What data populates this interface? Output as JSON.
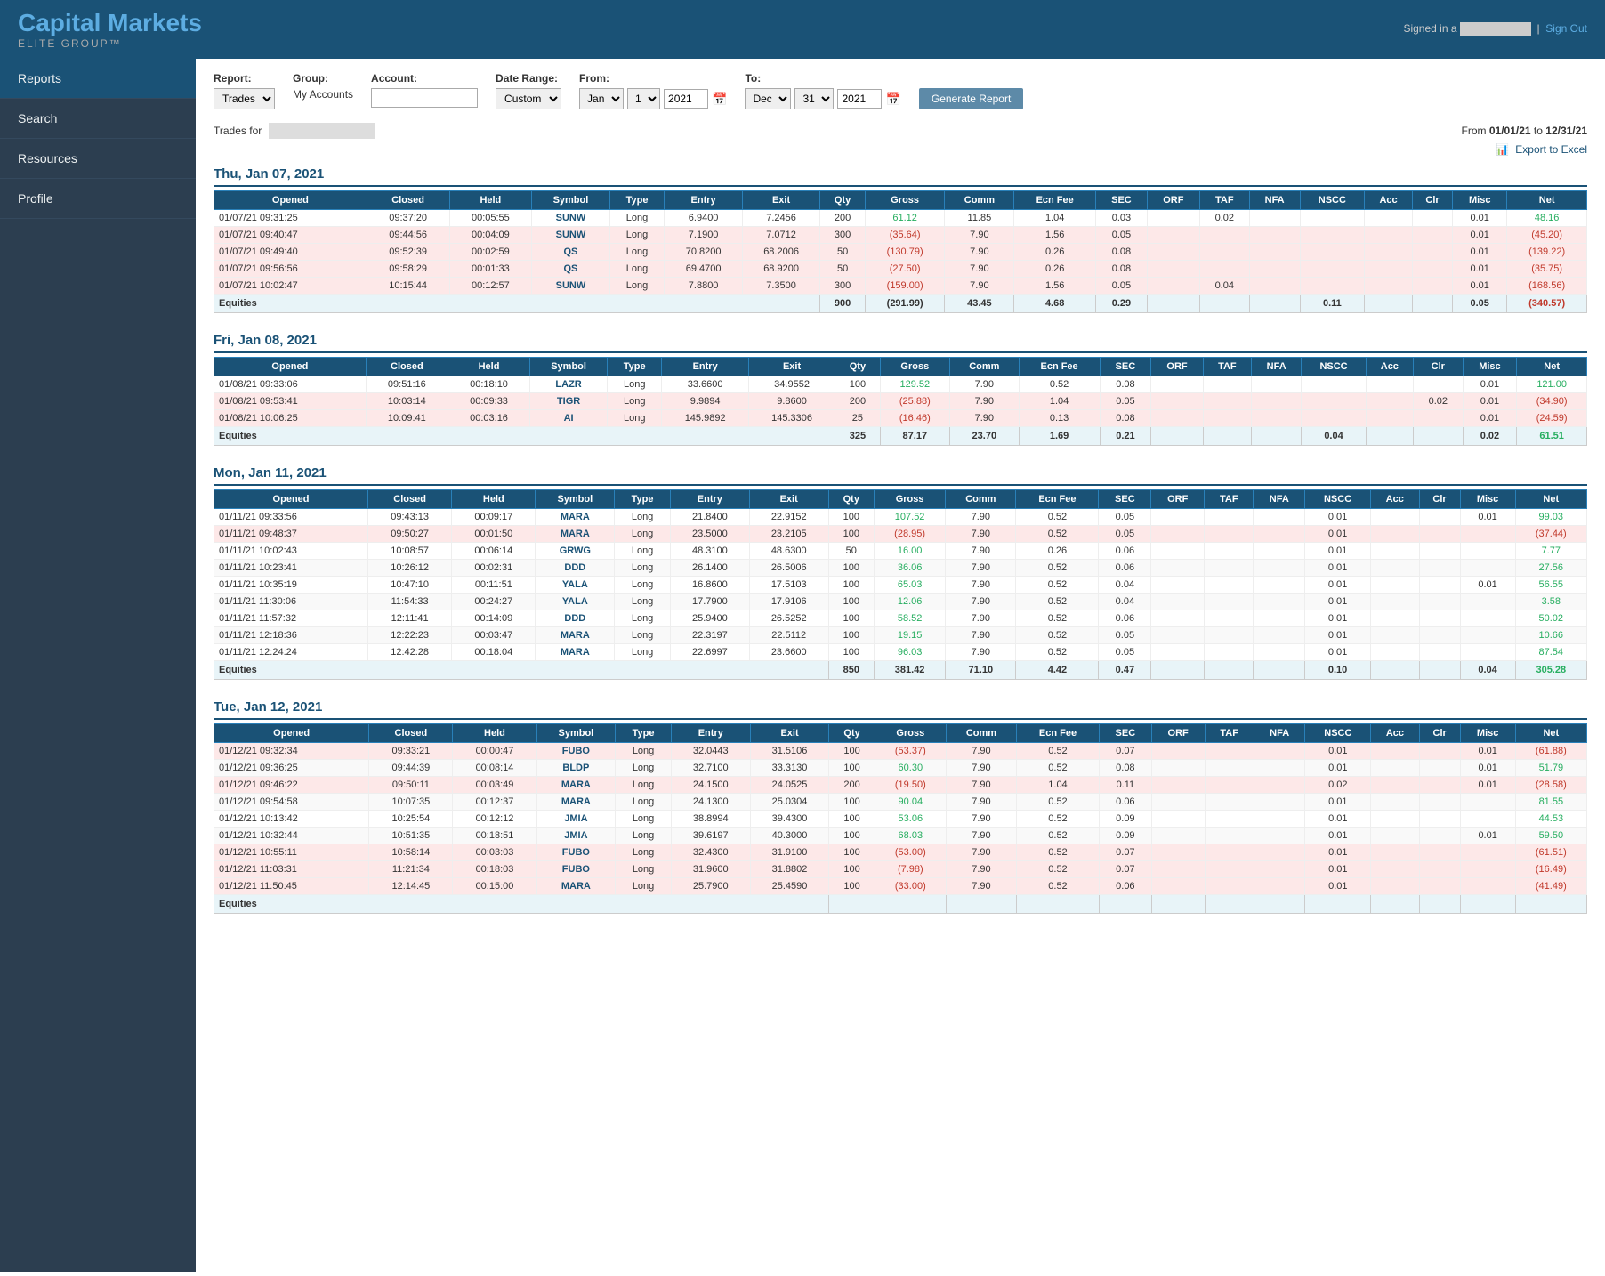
{
  "header": {
    "title": "Capital Markets",
    "subtitle": "ELITE GROUP™",
    "signed_in_label": "Signed in a",
    "sign_out_label": "Sign Out"
  },
  "sidebar": {
    "items": [
      {
        "label": "Reports",
        "active": true
      },
      {
        "label": "Search",
        "active": false
      },
      {
        "label": "Resources",
        "active": false
      },
      {
        "label": "Profile",
        "active": false
      }
    ]
  },
  "controls": {
    "report_label": "Report:",
    "report_value": "Trades",
    "group_label": "Group:",
    "group_value": "My Accounts",
    "account_label": "Account:",
    "account_value": "",
    "date_range_label": "Date Range:",
    "date_range_value": "Custom",
    "from_label": "From:",
    "from_month": "Jan",
    "from_day": "1",
    "from_year": "2021",
    "to_label": "To:",
    "to_month": "Dec",
    "to_day": "31",
    "to_year": "2021",
    "generate_button": "Generate Report"
  },
  "trades_for_label": "Trades for",
  "date_range_display": "From 01/01/21 to 12/31/21",
  "export_label": "Export to Excel",
  "days": [
    {
      "header": "Thu, Jan 07, 2021",
      "columns": [
        "Opened",
        "Closed",
        "Held",
        "Symbol",
        "Type",
        "Entry",
        "Exit",
        "Qty",
        "Gross",
        "Comm",
        "Ecn Fee",
        "SEC",
        "ORF",
        "TAF",
        "NFA",
        "NSCC",
        "Acc",
        "Clr",
        "Misc",
        "Net"
      ],
      "rows": [
        {
          "opened": "01/07/21 09:31:25",
          "closed": "09:37:20",
          "held": "00:05:55",
          "symbol": "SUNW",
          "type": "Long",
          "entry": "6.9400",
          "exit": "7.2456",
          "qty": "200",
          "gross": "61.12",
          "comm": "11.85",
          "ecn": "1.04",
          "sec": "0.03",
          "orf": "",
          "taf": "0.02",
          "nfa": "",
          "nscc": "",
          "acc": "",
          "clr": "",
          "misc": "0.01",
          "net": "48.16",
          "neg": false
        },
        {
          "opened": "01/07/21 09:40:47",
          "closed": "09:44:56",
          "held": "00:04:09",
          "symbol": "SUNW",
          "type": "Long",
          "entry": "7.1900",
          "exit": "7.0712",
          "qty": "300",
          "gross": "(35.64)",
          "comm": "7.90",
          "ecn": "1.56",
          "sec": "0.05",
          "orf": "",
          "taf": "",
          "nfa": "",
          "nscc": "",
          "acc": "",
          "clr": "",
          "misc": "0.01",
          "net": "(45.20)",
          "neg": true
        },
        {
          "opened": "01/07/21 09:49:40",
          "closed": "09:52:39",
          "held": "00:02:59",
          "symbol": "QS",
          "type": "Long",
          "entry": "70.8200",
          "exit": "68.2006",
          "qty": "50",
          "gross": "(130.79)",
          "comm": "7.90",
          "ecn": "0.26",
          "sec": "0.08",
          "orf": "",
          "taf": "",
          "nfa": "",
          "nscc": "",
          "acc": "",
          "clr": "",
          "misc": "0.01",
          "net": "(139.22)",
          "neg": true
        },
        {
          "opened": "01/07/21 09:56:56",
          "closed": "09:58:29",
          "held": "00:01:33",
          "symbol": "QS",
          "type": "Long",
          "entry": "69.4700",
          "exit": "68.9200",
          "qty": "50",
          "gross": "(27.50)",
          "comm": "7.90",
          "ecn": "0.26",
          "sec": "0.08",
          "orf": "",
          "taf": "",
          "nfa": "",
          "nscc": "",
          "acc": "",
          "clr": "",
          "misc": "0.01",
          "net": "(35.75)",
          "neg": true
        },
        {
          "opened": "01/07/21 10:02:47",
          "closed": "10:15:44",
          "held": "00:12:57",
          "symbol": "SUNW",
          "type": "Long",
          "entry": "7.8800",
          "exit": "7.3500",
          "qty": "300",
          "gross": "(159.00)",
          "comm": "7.90",
          "ecn": "1.56",
          "sec": "0.05",
          "orf": "",
          "taf": "0.04",
          "nfa": "",
          "nscc": "",
          "acc": "",
          "clr": "",
          "misc": "0.01",
          "net": "(168.56)",
          "neg": true
        }
      ],
      "footer": {
        "label": "Equities",
        "qty": "900",
        "gross": "(291.99)",
        "comm": "43.45",
        "ecn": "4.68",
        "sec": "0.29",
        "orf": "",
        "taf": "",
        "nfa": "",
        "nscc": "0.11",
        "acc": "",
        "clr": "",
        "misc": "0.05",
        "net": "(340.57)",
        "neg": true
      }
    },
    {
      "header": "Fri, Jan 08, 2021",
      "columns": [
        "Opened",
        "Closed",
        "Held",
        "Symbol",
        "Type",
        "Entry",
        "Exit",
        "Qty",
        "Gross",
        "Comm",
        "Ecn Fee",
        "SEC",
        "ORF",
        "TAF",
        "NFA",
        "NSCC",
        "Acc",
        "Clr",
        "Misc",
        "Net"
      ],
      "rows": [
        {
          "opened": "01/08/21 09:33:06",
          "closed": "09:51:16",
          "held": "00:18:10",
          "symbol": "LAZR",
          "type": "Long",
          "entry": "33.6600",
          "exit": "34.9552",
          "qty": "100",
          "gross": "129.52",
          "comm": "7.90",
          "ecn": "0.52",
          "sec": "0.08",
          "orf": "",
          "taf": "",
          "nfa": "",
          "nscc": "",
          "acc": "",
          "clr": "",
          "misc": "0.01",
          "net": "121.00",
          "neg": false
        },
        {
          "opened": "01/08/21 09:53:41",
          "closed": "10:03:14",
          "held": "00:09:33",
          "symbol": "TIGR",
          "type": "Long",
          "entry": "9.9894",
          "exit": "9.8600",
          "qty": "200",
          "gross": "(25.88)",
          "comm": "7.90",
          "ecn": "1.04",
          "sec": "0.05",
          "orf": "",
          "taf": "",
          "nfa": "",
          "nscc": "",
          "acc": "",
          "clr": "0.02",
          "misc": "0.01",
          "net": "(34.90)",
          "neg": true
        },
        {
          "opened": "01/08/21 10:06:25",
          "closed": "10:09:41",
          "held": "00:03:16",
          "symbol": "AI",
          "type": "Long",
          "entry": "145.9892",
          "exit": "145.3306",
          "qty": "25",
          "gross": "(16.46)",
          "comm": "7.90",
          "ecn": "0.13",
          "sec": "0.08",
          "orf": "",
          "taf": "",
          "nfa": "",
          "nscc": "",
          "acc": "",
          "clr": "",
          "misc": "0.01",
          "net": "(24.59)",
          "neg": true
        }
      ],
      "footer": {
        "label": "Equities",
        "qty": "325",
        "gross": "87.17",
        "comm": "23.70",
        "ecn": "1.69",
        "sec": "0.21",
        "orf": "",
        "taf": "",
        "nfa": "",
        "nscc": "0.04",
        "acc": "",
        "clr": "",
        "misc": "0.02",
        "net": "61.51",
        "neg": false
      }
    },
    {
      "header": "Mon, Jan 11, 2021",
      "columns": [
        "Opened",
        "Closed",
        "Held",
        "Symbol",
        "Type",
        "Entry",
        "Exit",
        "Qty",
        "Gross",
        "Comm",
        "Ecn Fee",
        "SEC",
        "ORF",
        "TAF",
        "NFA",
        "NSCC",
        "Acc",
        "Clr",
        "Misc",
        "Net"
      ],
      "rows": [
        {
          "opened": "01/11/21 09:33:56",
          "closed": "09:43:13",
          "held": "00:09:17",
          "symbol": "MARA",
          "type": "Long",
          "entry": "21.8400",
          "exit": "22.9152",
          "qty": "100",
          "gross": "107.52",
          "comm": "7.90",
          "ecn": "0.52",
          "sec": "0.05",
          "orf": "",
          "taf": "",
          "nfa": "",
          "nscc": "0.01",
          "acc": "",
          "clr": "",
          "misc": "0.01",
          "net": "99.03",
          "neg": false
        },
        {
          "opened": "01/11/21 09:48:37",
          "closed": "09:50:27",
          "held": "00:01:50",
          "symbol": "MARA",
          "type": "Long",
          "entry": "23.5000",
          "exit": "23.2105",
          "qty": "100",
          "gross": "(28.95)",
          "comm": "7.90",
          "ecn": "0.52",
          "sec": "0.05",
          "orf": "",
          "taf": "",
          "nfa": "",
          "nscc": "0.01",
          "acc": "",
          "clr": "",
          "misc": "",
          "net": "(37.44)",
          "neg": true
        },
        {
          "opened": "01/11/21 10:02:43",
          "closed": "10:08:57",
          "held": "00:06:14",
          "symbol": "GRWG",
          "type": "Long",
          "entry": "48.3100",
          "exit": "48.6300",
          "qty": "50",
          "gross": "16.00",
          "comm": "7.90",
          "ecn": "0.26",
          "sec": "0.06",
          "orf": "",
          "taf": "",
          "nfa": "",
          "nscc": "0.01",
          "acc": "",
          "clr": "",
          "misc": "",
          "net": "7.77",
          "neg": false
        },
        {
          "opened": "01/11/21 10:23:41",
          "closed": "10:26:12",
          "held": "00:02:31",
          "symbol": "DDD",
          "type": "Long",
          "entry": "26.1400",
          "exit": "26.5006",
          "qty": "100",
          "gross": "36.06",
          "comm": "7.90",
          "ecn": "0.52",
          "sec": "0.06",
          "orf": "",
          "taf": "",
          "nfa": "",
          "nscc": "0.01",
          "acc": "",
          "clr": "",
          "misc": "",
          "net": "27.56",
          "neg": false
        },
        {
          "opened": "01/11/21 10:35:19",
          "closed": "10:47:10",
          "held": "00:11:51",
          "symbol": "YALA",
          "type": "Long",
          "entry": "16.8600",
          "exit": "17.5103",
          "qty": "100",
          "gross": "65.03",
          "comm": "7.90",
          "ecn": "0.52",
          "sec": "0.04",
          "orf": "",
          "taf": "",
          "nfa": "",
          "nscc": "0.01",
          "acc": "",
          "clr": "",
          "misc": "0.01",
          "net": "56.55",
          "neg": false
        },
        {
          "opened": "01/11/21 11:30:06",
          "closed": "11:54:33",
          "held": "00:24:27",
          "symbol": "YALA",
          "type": "Long",
          "entry": "17.7900",
          "exit": "17.9106",
          "qty": "100",
          "gross": "12.06",
          "comm": "7.90",
          "ecn": "0.52",
          "sec": "0.04",
          "orf": "",
          "taf": "",
          "nfa": "",
          "nscc": "0.01",
          "acc": "",
          "clr": "",
          "misc": "",
          "net": "3.58",
          "neg": false
        },
        {
          "opened": "01/11/21 11:57:32",
          "closed": "12:11:41",
          "held": "00:14:09",
          "symbol": "DDD",
          "type": "Long",
          "entry": "25.9400",
          "exit": "26.5252",
          "qty": "100",
          "gross": "58.52",
          "comm": "7.90",
          "ecn": "0.52",
          "sec": "0.06",
          "orf": "",
          "taf": "",
          "nfa": "",
          "nscc": "0.01",
          "acc": "",
          "clr": "",
          "misc": "",
          "net": "50.02",
          "neg": false
        },
        {
          "opened": "01/11/21 12:18:36",
          "closed": "12:22:23",
          "held": "00:03:47",
          "symbol": "MARA",
          "type": "Long",
          "entry": "22.3197",
          "exit": "22.5112",
          "qty": "100",
          "gross": "19.15",
          "comm": "7.90",
          "ecn": "0.52",
          "sec": "0.05",
          "orf": "",
          "taf": "",
          "nfa": "",
          "nscc": "0.01",
          "acc": "",
          "clr": "",
          "misc": "",
          "net": "10.66",
          "neg": false
        },
        {
          "opened": "01/11/21 12:24:24",
          "closed": "12:42:28",
          "held": "00:18:04",
          "symbol": "MARA",
          "type": "Long",
          "entry": "22.6997",
          "exit": "23.6600",
          "qty": "100",
          "gross": "96.03",
          "comm": "7.90",
          "ecn": "0.52",
          "sec": "0.05",
          "orf": "",
          "taf": "",
          "nfa": "",
          "nscc": "0.01",
          "acc": "",
          "clr": "",
          "misc": "",
          "net": "87.54",
          "neg": false
        }
      ],
      "footer": {
        "label": "Equities",
        "qty": "850",
        "gross": "381.42",
        "comm": "71.10",
        "ecn": "4.42",
        "sec": "0.47",
        "orf": "",
        "taf": "",
        "nfa": "",
        "nscc": "0.10",
        "acc": "",
        "clr": "",
        "misc": "0.04",
        "net": "305.28",
        "neg": false
      }
    },
    {
      "header": "Tue, Jan 12, 2021",
      "columns": [
        "Opened",
        "Closed",
        "Held",
        "Symbol",
        "Type",
        "Entry",
        "Exit",
        "Qty",
        "Gross",
        "Comm",
        "Ecn Fee",
        "SEC",
        "ORF",
        "TAF",
        "NFA",
        "NSCC",
        "Acc",
        "Clr",
        "Misc",
        "Net"
      ],
      "rows": [
        {
          "opened": "01/12/21 09:32:34",
          "closed": "09:33:21",
          "held": "00:00:47",
          "symbol": "FUBO",
          "type": "Long",
          "entry": "32.0443",
          "exit": "31.5106",
          "qty": "100",
          "gross": "(53.37)",
          "comm": "7.90",
          "ecn": "0.52",
          "sec": "0.07",
          "orf": "",
          "taf": "",
          "nfa": "",
          "nscc": "0.01",
          "acc": "",
          "clr": "",
          "misc": "0.01",
          "net": "(61.88)",
          "neg": true
        },
        {
          "opened": "01/12/21 09:36:25",
          "closed": "09:44:39",
          "held": "00:08:14",
          "symbol": "BLDP",
          "type": "Long",
          "entry": "32.7100",
          "exit": "33.3130",
          "qty": "100",
          "gross": "60.30",
          "comm": "7.90",
          "ecn": "0.52",
          "sec": "0.08",
          "orf": "",
          "taf": "",
          "nfa": "",
          "nscc": "0.01",
          "acc": "",
          "clr": "",
          "misc": "0.01",
          "net": "51.79",
          "neg": false
        },
        {
          "opened": "01/12/21 09:46:22",
          "closed": "09:50:11",
          "held": "00:03:49",
          "symbol": "MARA",
          "type": "Long",
          "entry": "24.1500",
          "exit": "24.0525",
          "qty": "200",
          "gross": "(19.50)",
          "comm": "7.90",
          "ecn": "1.04",
          "sec": "0.11",
          "orf": "",
          "taf": "",
          "nfa": "",
          "nscc": "0.02",
          "acc": "",
          "clr": "",
          "misc": "0.01",
          "net": "(28.58)",
          "neg": true
        },
        {
          "opened": "01/12/21 09:54:58",
          "closed": "10:07:35",
          "held": "00:12:37",
          "symbol": "MARA",
          "type": "Long",
          "entry": "24.1300",
          "exit": "25.0304",
          "qty": "100",
          "gross": "90.04",
          "comm": "7.90",
          "ecn": "0.52",
          "sec": "0.06",
          "orf": "",
          "taf": "",
          "nfa": "",
          "nscc": "0.01",
          "acc": "",
          "clr": "",
          "misc": "",
          "net": "81.55",
          "neg": false
        },
        {
          "opened": "01/12/21 10:13:42",
          "closed": "10:25:54",
          "held": "00:12:12",
          "symbol": "JMIA",
          "type": "Long",
          "entry": "38.8994",
          "exit": "39.4300",
          "qty": "100",
          "gross": "53.06",
          "comm": "7.90",
          "ecn": "0.52",
          "sec": "0.09",
          "orf": "",
          "taf": "",
          "nfa": "",
          "nscc": "0.01",
          "acc": "",
          "clr": "",
          "misc": "",
          "net": "44.53",
          "neg": false
        },
        {
          "opened": "01/12/21 10:32:44",
          "closed": "10:51:35",
          "held": "00:18:51",
          "symbol": "JMIA",
          "type": "Long",
          "entry": "39.6197",
          "exit": "40.3000",
          "qty": "100",
          "gross": "68.03",
          "comm": "7.90",
          "ecn": "0.52",
          "sec": "0.09",
          "orf": "",
          "taf": "",
          "nfa": "",
          "nscc": "0.01",
          "acc": "",
          "clr": "",
          "misc": "0.01",
          "net": "59.50",
          "neg": false
        },
        {
          "opened": "01/12/21 10:55:11",
          "closed": "10:58:14",
          "held": "00:03:03",
          "symbol": "FUBO",
          "type": "Long",
          "entry": "32.4300",
          "exit": "31.9100",
          "qty": "100",
          "gross": "(53.00)",
          "comm": "7.90",
          "ecn": "0.52",
          "sec": "0.07",
          "orf": "",
          "taf": "",
          "nfa": "",
          "nscc": "0.01",
          "acc": "",
          "clr": "",
          "misc": "",
          "net": "(61.51)",
          "neg": true
        },
        {
          "opened": "01/12/21 11:03:31",
          "closed": "11:21:34",
          "held": "00:18:03",
          "symbol": "FUBO",
          "type": "Long",
          "entry": "31.9600",
          "exit": "31.8802",
          "qty": "100",
          "gross": "(7.98)",
          "comm": "7.90",
          "ecn": "0.52",
          "sec": "0.07",
          "orf": "",
          "taf": "",
          "nfa": "",
          "nscc": "0.01",
          "acc": "",
          "clr": "",
          "misc": "",
          "net": "(16.49)",
          "neg": true
        },
        {
          "opened": "01/12/21 11:50:45",
          "closed": "12:14:45",
          "held": "00:15:00",
          "symbol": "MARA",
          "type": "Long",
          "entry": "25.7900",
          "exit": "25.4590",
          "qty": "100",
          "gross": "(33.00)",
          "comm": "7.90",
          "ecn": "0.52",
          "sec": "0.06",
          "orf": "",
          "taf": "",
          "nfa": "",
          "nscc": "0.01",
          "acc": "",
          "clr": "",
          "misc": "",
          "net": "(41.49)",
          "neg": true
        }
      ],
      "footer": {
        "label": "Equities",
        "qty": "",
        "gross": "",
        "comm": "",
        "ecn": "",
        "sec": "",
        "orf": "",
        "taf": "",
        "nfa": "",
        "nscc": "",
        "acc": "",
        "clr": "",
        "misc": "",
        "net": "",
        "neg": false
      }
    }
  ]
}
